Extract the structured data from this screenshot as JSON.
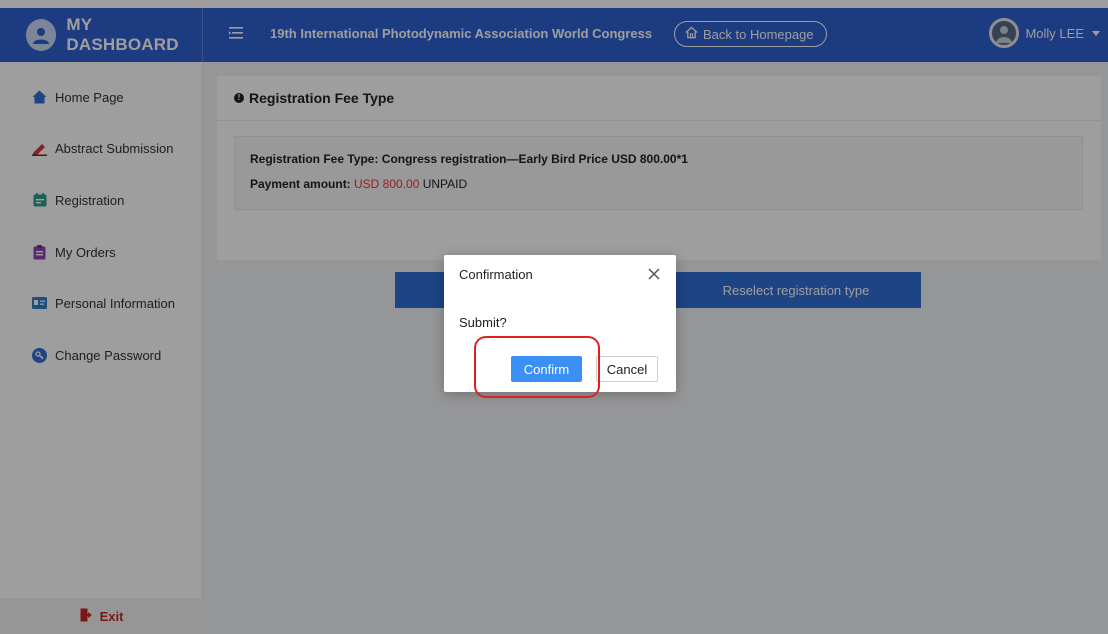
{
  "header": {
    "brand": "MY DASHBOARD",
    "congress_title": "19th International Photodynamic Association World Congress",
    "back_home_label": "Back to Homepage",
    "user_name": "Molly LEE"
  },
  "sidebar": {
    "items": [
      {
        "label": "Home Page",
        "icon": "home-icon"
      },
      {
        "label": "Abstract Submission",
        "icon": "pen-icon"
      },
      {
        "label": "Registration",
        "icon": "calendar-icon"
      },
      {
        "label": "My Orders",
        "icon": "clipboard-icon"
      },
      {
        "label": "Personal Information",
        "icon": "id-card-icon"
      },
      {
        "label": "Change Password",
        "icon": "key-icon"
      }
    ],
    "exit_label": "Exit"
  },
  "main": {
    "card_title": "Registration Fee Type",
    "fee_line": "Registration Fee Type:  Congress registration—Early Bird Price USD 800.00*1",
    "payment_label": "Payment amount: ",
    "payment_amount": "USD 800.00",
    "payment_status": " UNPAID",
    "reselect_button": "Reselect registration type"
  },
  "dialog": {
    "title": "Confirmation",
    "message": "Submit?",
    "confirm_label": "Confirm",
    "cancel_label": "Cancel"
  },
  "colors": {
    "header_blue": "#2f5fcf",
    "button_blue": "#2f6fd7",
    "confirm_blue": "#3b8ff5",
    "amount_red": "#e53935",
    "highlight_red": "#e02020"
  }
}
